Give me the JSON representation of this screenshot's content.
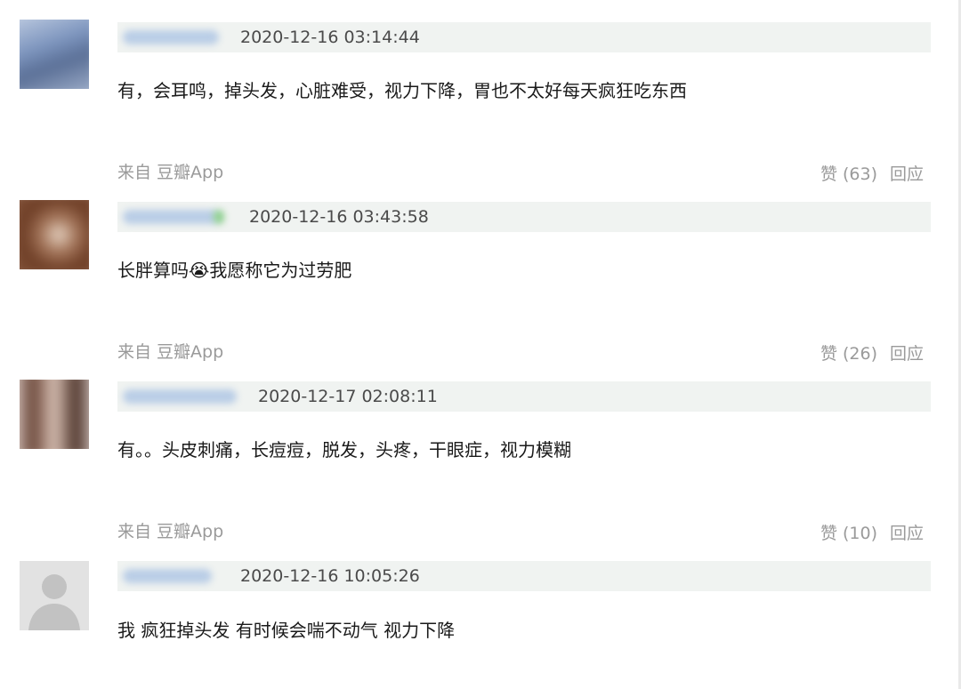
{
  "comments": [
    {
      "timestamp": "2020-12-16 03:14:44",
      "text": "有，会耳鸣，掉头发，心脏难受，视力下降，胃也不太好每天疯狂吃东西",
      "source": "来自 豆瓣App",
      "like": "赞 (63)",
      "reply": "回应"
    },
    {
      "timestamp": "2020-12-16 03:43:58",
      "text": "长胖算吗😭我愿称它为过劳肥",
      "source": "来自 豆瓣App",
      "like": "赞 (26)",
      "reply": "回应"
    },
    {
      "timestamp": "2020-12-17 02:08:11",
      "text": "有。。头皮刺痛，长痘痘，脱发，头疼，干眼症，视力模糊",
      "source": "来自 豆瓣App",
      "like": "赞 (10)",
      "reply": "回应"
    },
    {
      "timestamp": "2020-12-16 10:05:26",
      "text": "我 疯狂掉头发 有时候会喘不动气 视力下降"
    }
  ],
  "colors": {
    "meta_bar_bg": "#f0f3f1",
    "muted_text": "#9a9a9a",
    "body_text": "#1a1a1a"
  }
}
